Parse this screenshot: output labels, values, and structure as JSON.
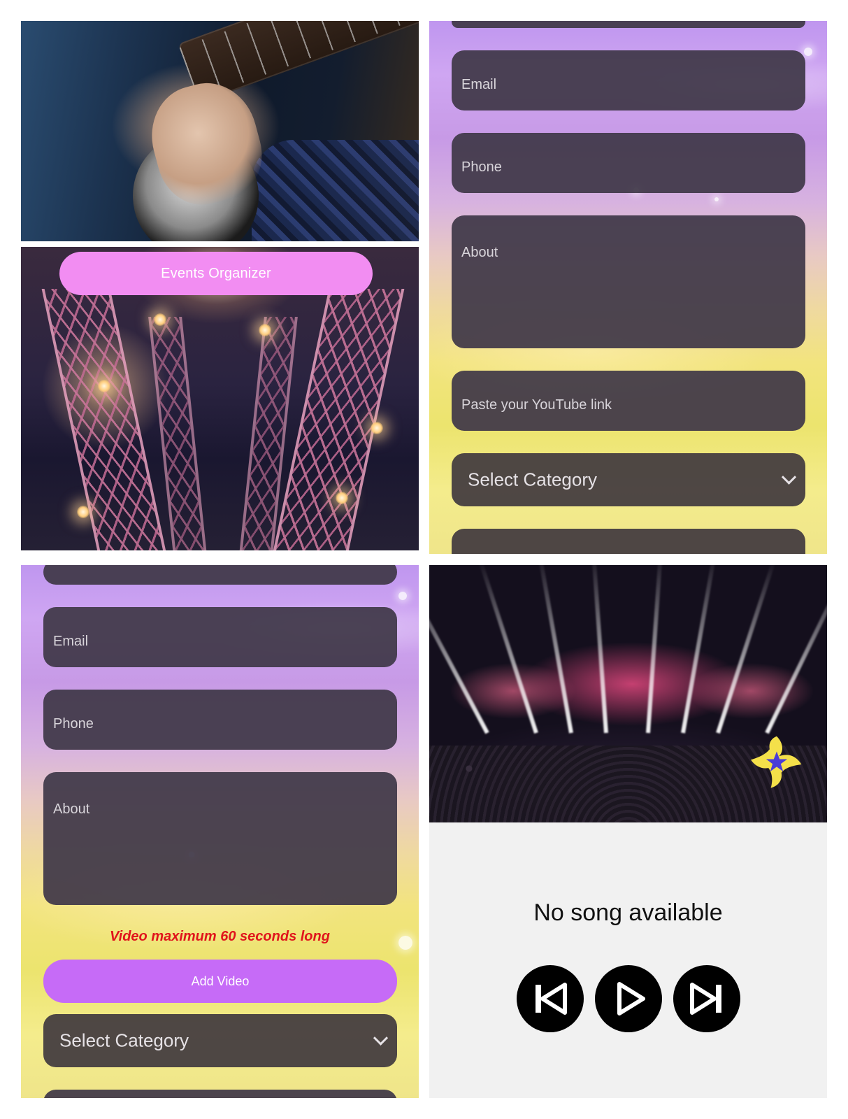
{
  "panel_organizer": {
    "button_label": "Events Organizer"
  },
  "form_top_right": {
    "fields": [
      {
        "placeholder": "Email"
      },
      {
        "placeholder": "Phone"
      },
      {
        "placeholder": "About"
      },
      {
        "placeholder": "Paste your YouTube link"
      }
    ],
    "select_category": "Select Category"
  },
  "form_bottom_left": {
    "fields": [
      {
        "placeholder": "Email"
      },
      {
        "placeholder": "Phone"
      },
      {
        "placeholder": "About"
      }
    ],
    "warning": "Video maximum 60 seconds long",
    "add_video_label": "Add Video",
    "select_category": "Select Category"
  },
  "player": {
    "status": "No song available",
    "controls": [
      "previous-icon",
      "play-icon",
      "next-icon"
    ]
  },
  "colors": {
    "organizer_pill": "#f28df2",
    "add_video_button": "#c66bf7",
    "warning_text": "#e0141c",
    "field_bg": "#403848"
  }
}
